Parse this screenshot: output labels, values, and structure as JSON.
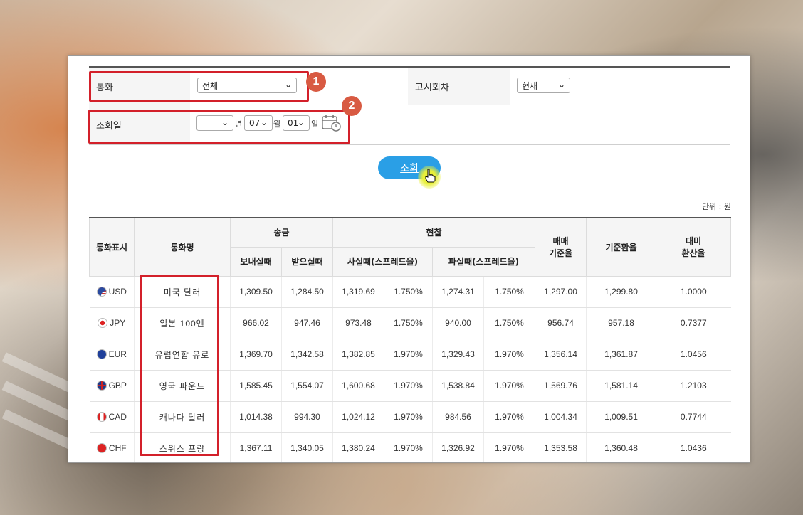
{
  "form": {
    "currency_label": "통화",
    "currency_value": "전체",
    "notice_label": "고시회차",
    "notice_value": "현재",
    "date_label": "조회일",
    "year_value": "",
    "year_suffix": "년",
    "month_value": "07",
    "month_suffix": "월",
    "day_value": "01",
    "day_suffix": "일",
    "search_button": "조회",
    "unit_text": "단위 : 원"
  },
  "annotations": {
    "badge1": "1",
    "badge2": "2"
  },
  "table": {
    "headers": {
      "code": "통화표시",
      "name": "통화명",
      "remit": "송금",
      "cash": "현찰",
      "send": "보내실때",
      "receive": "받으실때",
      "buy": "사실때(스프레드율)",
      "sell": "파실때(스프레드율)",
      "trade_base_1": "매매",
      "trade_base_2": "기준율",
      "base_rate": "기준환율",
      "usd_ratio_1": "대미",
      "usd_ratio_2": "환산율"
    },
    "rows": [
      {
        "code": "USD",
        "flag": "us-flag",
        "name": "미국 달러",
        "send": "1,309.50",
        "receive": "1,284.50",
        "buy": "1,319.69",
        "buy_spread": "1.750%",
        "sell": "1,274.31",
        "sell_spread": "1.750%",
        "trade": "1,297.00",
        "base": "1,299.80",
        "usd": "1.0000"
      },
      {
        "code": "JPY",
        "flag": "jp-flag",
        "name": "일본 100엔",
        "send": "966.02",
        "receive": "947.46",
        "buy": "973.48",
        "buy_spread": "1.750%",
        "sell": "940.00",
        "sell_spread": "1.750%",
        "trade": "956.74",
        "base": "957.18",
        "usd": "0.7377"
      },
      {
        "code": "EUR",
        "flag": "eu-flag",
        "name": "유럽연합 유로",
        "send": "1,369.70",
        "receive": "1,342.58",
        "buy": "1,382.85",
        "buy_spread": "1.970%",
        "sell": "1,329.43",
        "sell_spread": "1.970%",
        "trade": "1,356.14",
        "base": "1,361.87",
        "usd": "1.0456"
      },
      {
        "code": "GBP",
        "flag": "gb-flag",
        "name": "영국 파운드",
        "send": "1,585.45",
        "receive": "1,554.07",
        "buy": "1,600.68",
        "buy_spread": "1.970%",
        "sell": "1,538.84",
        "sell_spread": "1.970%",
        "trade": "1,569.76",
        "base": "1,581.14",
        "usd": "1.2103"
      },
      {
        "code": "CAD",
        "flag": "ca-flag",
        "name": "캐나다 달러",
        "send": "1,014.38",
        "receive": "994.30",
        "buy": "1,024.12",
        "buy_spread": "1.970%",
        "sell": "984.56",
        "sell_spread": "1.970%",
        "trade": "1,004.34",
        "base": "1,009.51",
        "usd": "0.7744"
      },
      {
        "code": "CHF",
        "flag": "ch-flag",
        "name": "스위스 프랑",
        "send": "1,367.11",
        "receive": "1,340.05",
        "buy": "1,380.24",
        "buy_spread": "1.970%",
        "sell": "1,326.92",
        "sell_spread": "1.970%",
        "trade": "1,353.58",
        "base": "1,360.48",
        "usd": "1.0436"
      }
    ]
  }
}
